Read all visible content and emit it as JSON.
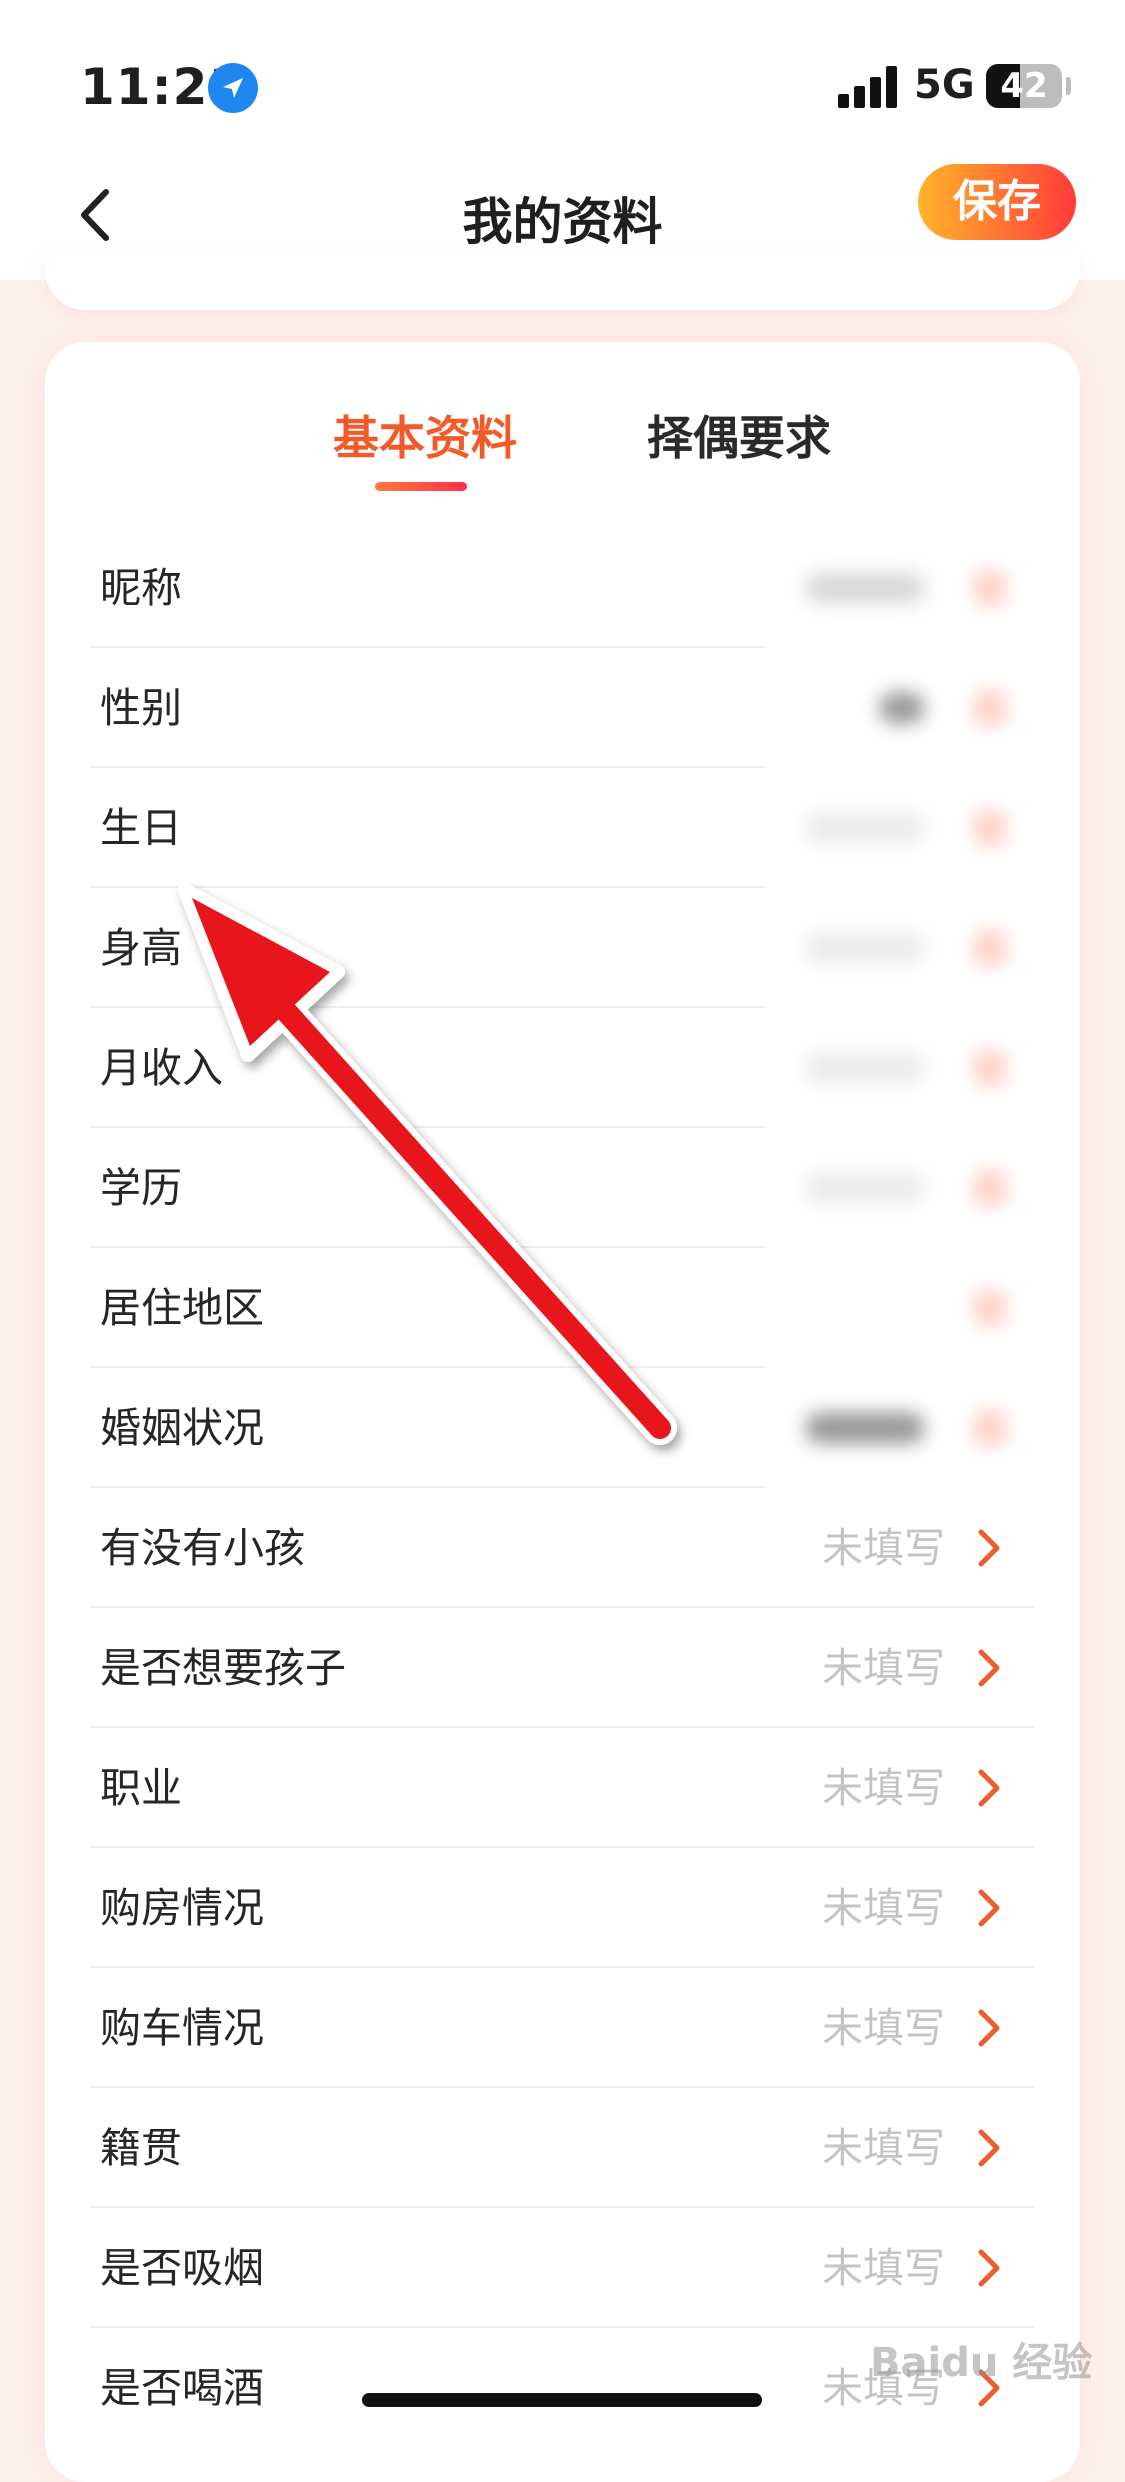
{
  "status_bar": {
    "time": "11:21",
    "network": "5G",
    "battery": "42",
    "icons": [
      "location-arrow-icon",
      "signal-icon",
      "battery-icon"
    ]
  },
  "nav": {
    "title": "我的资料",
    "save_label": "保存",
    "back_icon": "chevron-left-icon"
  },
  "tabs": [
    {
      "label": "基本资料",
      "active": true
    },
    {
      "label": "择偶要求",
      "active": false
    }
  ],
  "rows": [
    {
      "label": "昵称",
      "value": ""
    },
    {
      "label": "性别",
      "value": ""
    },
    {
      "label": "生日",
      "value": ""
    },
    {
      "label": "身高",
      "value": ""
    },
    {
      "label": "月收入",
      "value": ""
    },
    {
      "label": "学历",
      "value": ""
    },
    {
      "label": "居住地区",
      "value": ""
    },
    {
      "label": "婚姻状况",
      "value": ""
    },
    {
      "label": "有没有小孩",
      "value": "未填写"
    },
    {
      "label": "是否想要孩子",
      "value": "未填写"
    },
    {
      "label": "职业",
      "value": "未填写"
    },
    {
      "label": "购房情况",
      "value": "未填写"
    },
    {
      "label": "购车情况",
      "value": "未填写"
    },
    {
      "label": "籍贯",
      "value": "未填写"
    },
    {
      "label": "是否吸烟",
      "value": "未填写"
    },
    {
      "label": "是否喝酒",
      "value": "未填写"
    }
  ],
  "watermark": "Baidu 经验",
  "colors": {
    "accent": "#f25a2a",
    "save_gradient_start": "#ffb52a",
    "save_gradient_end": "#ff3b3b",
    "annotation_arrow": "#e8141c",
    "placeholder_text": "#c4c4c4"
  }
}
